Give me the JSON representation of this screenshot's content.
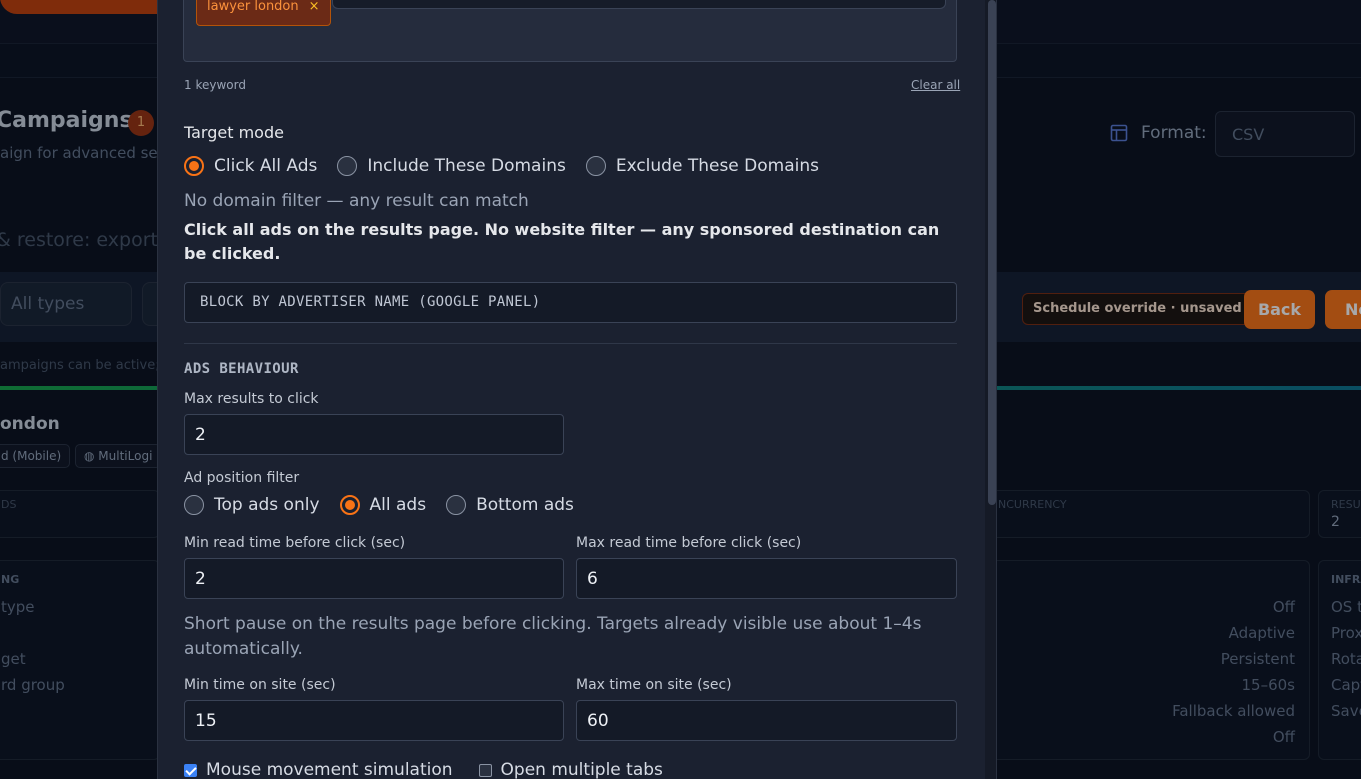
{
  "background": {
    "page_title": "Campaigns",
    "campaign_count": "1",
    "subtitle": "aign for advanced set",
    "backup_text": "& restore: export",
    "format_label": "Format:",
    "format_value": "CSV",
    "filter_types": "All types",
    "schedule_badge": "Schedule override · unsaved",
    "back_label": "Back",
    "next_label": "Ne",
    "note": "ampaigns can be active; th",
    "campaign_name": "ondon",
    "chip_device": "d (Mobile)",
    "chip_browser": "MultiLogi",
    "stat_left_label": "DS",
    "stat_concurrency_label": "NCURRENCY",
    "stat_results_label": "RESU",
    "stat_results_value": "2",
    "panel_left_head": "NG",
    "panel_left_rows": [
      "type",
      "",
      "get",
      "rd group"
    ],
    "panel_right_values": [
      "Off",
      "Adaptive",
      "Persistent",
      "15–60s",
      "Fallback allowed",
      "Off"
    ],
    "infra_head": "INFRA",
    "infra_rows": [
      "OS t",
      "Prox",
      "Rota",
      "Capt",
      "Save"
    ]
  },
  "modal": {
    "keyword_tag": "lawyer london",
    "keyword_tag_remove": "×",
    "keyword_count": "1 keyword",
    "clear_all": "Clear all",
    "target_mode_label": "Target mode",
    "target_modes": [
      {
        "label": "Click All Ads",
        "selected": true
      },
      {
        "label": "Include These Domains",
        "selected": false
      },
      {
        "label": "Exclude These Domains",
        "selected": false
      }
    ],
    "domain_hint": "No domain filter — any result can match",
    "mode_description": "Click all ads on the results page. No website filter — any sponsored destination can be clicked.",
    "block_advertiser_placeholder": "Block by advertiser name (Google panel)",
    "ads_behaviour_heading": "ADS BEHAVIOUR",
    "max_results_label": "Max results to click",
    "max_results_value": "2",
    "ad_position_label": "Ad position filter",
    "ad_positions": [
      {
        "label": "Top ads only",
        "selected": false
      },
      {
        "label": "All ads",
        "selected": true
      },
      {
        "label": "Bottom ads",
        "selected": false
      }
    ],
    "min_read_label": "Min read time before click (sec)",
    "min_read_value": "2",
    "max_read_label": "Max read time before click (sec)",
    "max_read_value": "6",
    "read_hint": "Short pause on the results page before clicking. Targets already visible use about 1–4s automatically.",
    "min_site_label": "Min time on site (sec)",
    "min_site_value": "15",
    "max_site_label": "Max time on site (sec)",
    "max_site_value": "60",
    "mouse_sim_label": "Mouse movement simulation",
    "mouse_sim_checked": true,
    "multi_tabs_label": "Open multiple tabs",
    "multi_tabs_checked": false
  },
  "colors": {
    "accent": "#f97316",
    "checkbox_blue": "#3b82f6",
    "modal_bg": "#1b2130"
  }
}
